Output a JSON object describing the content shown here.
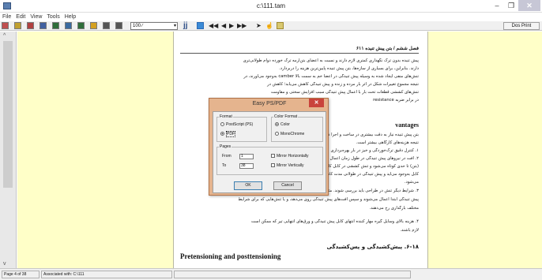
{
  "window": {
    "title": "c:\\111.tam",
    "min_glyph": "–",
    "max_glyph": "❐",
    "close_glyph": "✕"
  },
  "menu": [
    "File",
    "Edit",
    "View",
    "Tools",
    "Help"
  ],
  "toolbar": {
    "zoom_value": "100 ∕",
    "zoom_arrow": "▾",
    "big_jj": "jj",
    "first_page": "◀◀",
    "prev_page": "◀",
    "next_page": "▶",
    "last_page": "▶▶",
    "select_tool": "➤",
    "hand_tool": "☝",
    "dos_print_label": "Dos Print",
    "icon_colors": [
      "#c05050",
      "#c0a030",
      "#b04040",
      "#4060a0",
      "#2f6e3a",
      "#3a6aa0",
      "#2f6e3a",
      "#d4a020",
      "#555555",
      "#555555"
    ]
  },
  "document": {
    "page_header": "فصل ششم / بتن پیش تنیده ۶۱۱",
    "lines": [
      "پیش تنیده بدون ترک نگهداری کمتری لازم دارند و نسبت به اعضای بتن‌آرمه ترک خورده دوام طولانی‌تری",
      "دارند. بنابراین، برای بسیاری از سازه‌ها، بتن پیش تنیده پایین‌ترین هزینه را دربردارد.",
      "تنش‌های منفی ایجاد شده به وسیله پیش تنیدگی در اعضا خم به سمت بالا camber به‌وجود می‌آورند، در",
      "نتیجه مجموع تغییرات شکل در اثر بار مرده و زنده و پیش تنیدگی کاهش می‌یابد؛ کاهش در",
      "تنش‌های کششی قطعات تحت بار با اعمال پیش تنیدگی سبب افزایش سختی و مقاومت",
      "در برابر ضربه resistance"
    ],
    "heading_right_en": "vantages",
    "lines2": [
      "بتن پیش تنیده نیاز به دقت بیشتری در ساخت و اجرا دارد، در نتیجه",
      "نتیجه هزینه‌های کارگاهی بیشتر است.",
      "۱. کنترل دقیق ترک‌خوردگی و خیز در بار بهره‌برداری",
      "۲. افت در نیروهای پیش تنیدگی در طول زمان اعمال می‌شود",
      "(بتن) تا حدی کوتاه می‌شود و تنش کششی در کابل کاسته می‌شود",
      "کابل به‌وجود می‌آید و پیش تنیدگی در طولانی مدت کاهش می‌یابد",
      "می‌شود.",
      "۳. شرایط دیگر تنش در طراحی باید بررسی شوند. مثلاً تنش‌های ایجاد شده هنگامی که نیروهای",
      "پیش تنیدگی ابتدا اعمال می‌شوند و سپس افت‌های پیش تنیدگی روی می‌دهد، و یا تنش‌هایی که برای شرایط",
      "مختلف بارگذاری رخ می‌دهند.",
      "۴. هزینه بالای وسایل گیره مهار کننده انتهای کابل پیش تنیدگی و ورق‌های انتهایی تیر که ممکن است",
      "لازم باشند."
    ],
    "heading_fa": "۶-۱۸. پیش‌کشیدگی و پس‌کشیدگی",
    "heading_en": "Pretensioning and posttensioning"
  },
  "dialog": {
    "title": "Easy PS/PDF",
    "close_glyph": "✕",
    "format_label": "Format",
    "postscript_label": "PostScript (PS)",
    "pdf_label": "PDF",
    "color_format_label": "Color Format",
    "color_label": "Color",
    "monochrome_label": "MonoChrome",
    "pages_label": "Pages",
    "from_label": "From",
    "from_value": "1",
    "to_label": "To",
    "to_value": "38",
    "mirror_h_label": "Mirror Horizontally",
    "mirror_v_label": "Mirror Vertically",
    "ok_label": "OK",
    "cancel_label": "Cancel"
  },
  "scroll": {
    "up_glyph": "^",
    "down_glyph": "v"
  },
  "status": {
    "page_info": "Page 4 of 38",
    "association": "Associated with: C:\\111"
  }
}
